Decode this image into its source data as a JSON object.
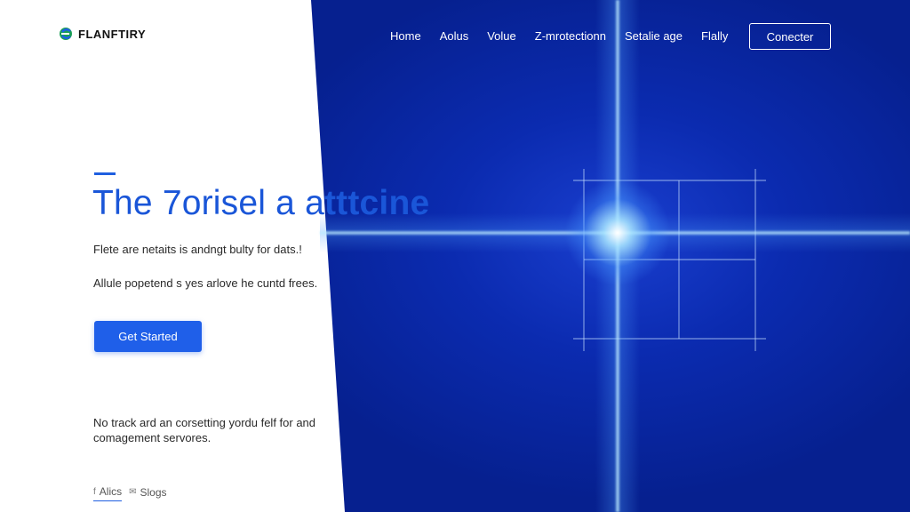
{
  "brand": {
    "name": "FLANFTIRY",
    "colors": {
      "primary": "#1f5fe9",
      "hero_blue": "#0b2bb0",
      "glow": "#bfe9ff"
    }
  },
  "nav": {
    "items": [
      "Home",
      "Aolus",
      "Volue",
      "Z-mrotectionn",
      "Setalie age",
      "Flally"
    ],
    "button": "Conecter"
  },
  "hero": {
    "headline_light": "The 7orisel a a",
    "headline_bold": "tttcine",
    "line1": "Flete are netaits is andngt bulty for dats.!",
    "line2": "Allule popetend s yes arlove he cuntd frees.",
    "cta": "Get Started"
  },
  "footer": {
    "text": "No track ard an corsetting yordu felf for and comagement servores.",
    "links": [
      {
        "icon": "facebook-icon",
        "glyph": "f",
        "label": "Alics"
      },
      {
        "icon": "twitter-icon",
        "glyph": "✉",
        "label": "Slogs"
      }
    ]
  }
}
